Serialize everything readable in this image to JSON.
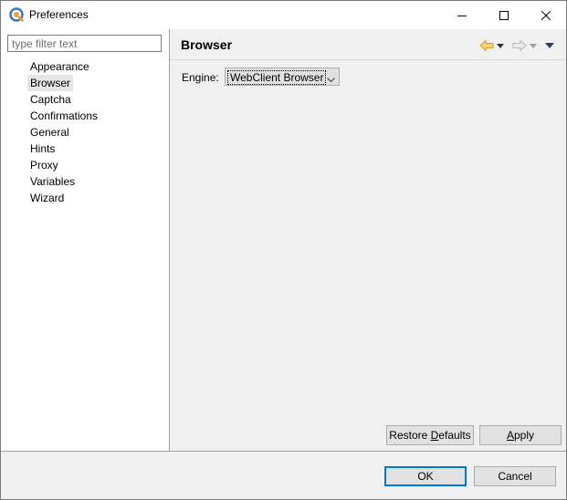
{
  "window": {
    "title": "Preferences"
  },
  "filter": {
    "placeholder": "type filter text",
    "value": ""
  },
  "tree": {
    "items": [
      "Appearance",
      "Browser",
      "Captcha",
      "Confirmations",
      "General",
      "Hints",
      "Proxy",
      "Variables",
      "Wizard"
    ],
    "selected": "Browser"
  },
  "page": {
    "title": "Browser",
    "engine_label": "Engine:",
    "engine_value": "WebClient Browser"
  },
  "buttons": {
    "restore_pre": "Restore ",
    "restore_ul": "D",
    "restore_post": "efaults",
    "apply_pre": "",
    "apply_ul": "A",
    "apply_post": "pply",
    "ok": "OK",
    "cancel": "Cancel"
  },
  "icons": {
    "app": "app-icon",
    "minimize": "minimize-icon",
    "maximize": "maximize-icon",
    "close": "close-icon",
    "back": "back-arrow-icon",
    "forward": "forward-arrow-icon",
    "menu": "view-menu-icon"
  },
  "colors": {
    "nav_arrow_active": "#e8b84a",
    "nav_arrow_disabled": "#c8c8c8",
    "default_button_border": "#0078d7",
    "selection": "#e5e5e5"
  }
}
